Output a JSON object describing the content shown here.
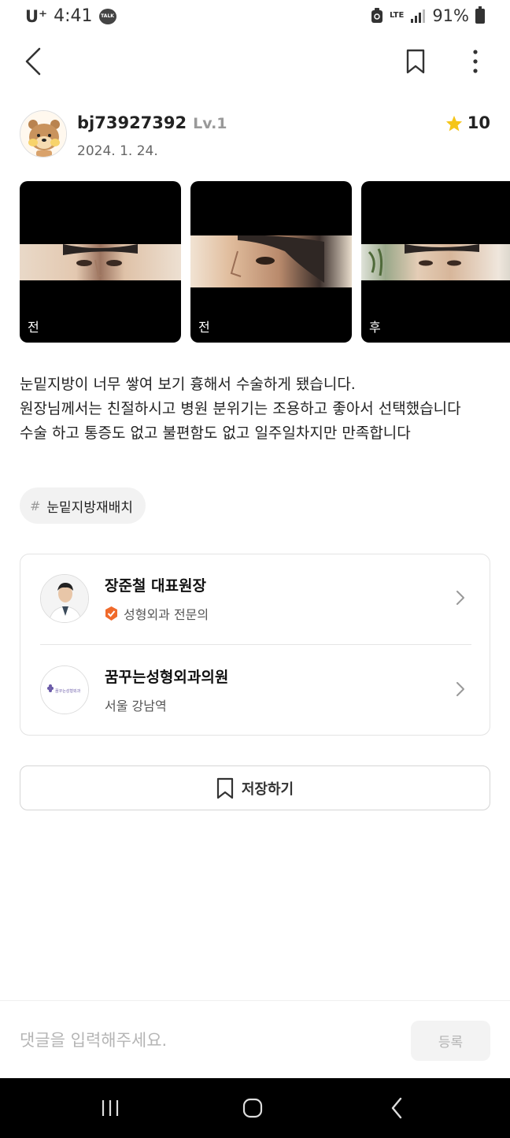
{
  "status_bar": {
    "carrier": "U⁺",
    "time": "4:41",
    "talk_badge": "TALK",
    "network": "LTE",
    "battery": "91%"
  },
  "header": {
    "icons": [
      "back-icon",
      "bookmark-icon",
      "more-icon"
    ]
  },
  "author": {
    "username": "bj73927392",
    "level": "Lv.1",
    "date": "2024. 1. 24.",
    "rating": "10"
  },
  "photos": [
    {
      "label": "전"
    },
    {
      "label": "전"
    },
    {
      "label": "후"
    }
  ],
  "review": {
    "lines": [
      "눈밑지방이 너무 쌓여 보기 흉해서 수술하게 됐습니다.",
      "원장님께서는 친절하시고 병원 분위기는 조용하고 좋아서 선택했습니다",
      "수술 하고 통증도 없고 불편함도 없고 일주일차지만 만족합니다"
    ]
  },
  "tag": {
    "hash": "#",
    "label": "눈밑지방재배치"
  },
  "doctor": {
    "name": "장준철 대표원장",
    "specialty": "성형외과 전문의"
  },
  "clinic": {
    "name": "꿈꾸는성형외과의원",
    "location": "서울 강남역",
    "logo_text": "꿈꾸는성형외과"
  },
  "save_button": {
    "label": "저장하기"
  },
  "comment": {
    "placeholder": "댓글을 입력해주세요.",
    "submit_label": "등록"
  },
  "colors": {
    "star": "#f5c518",
    "verified_badge": "#f06a2b",
    "chip_bg": "#f2f2f2"
  }
}
